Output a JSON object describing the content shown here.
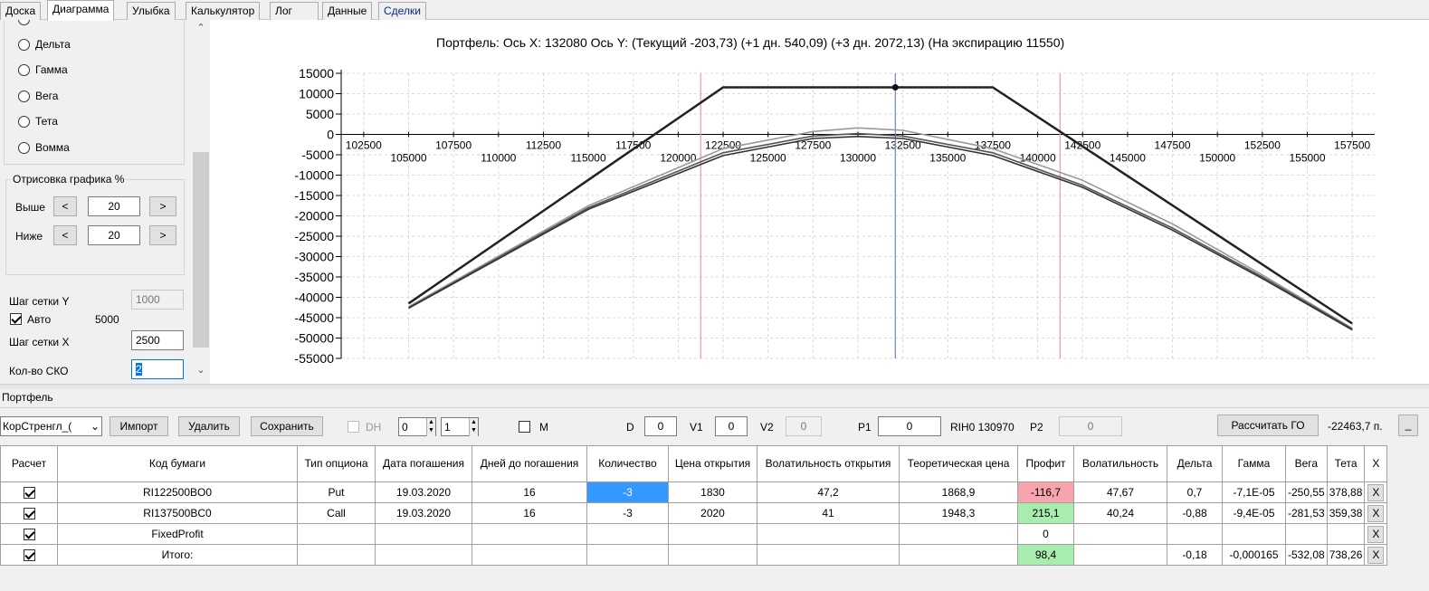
{
  "tabs": [
    {
      "label": "Доска"
    },
    {
      "label": "Диаграмма"
    },
    {
      "label": "Улыбка"
    },
    {
      "label": "Калькулятор"
    },
    {
      "label": "Лог"
    },
    {
      "label": "Данные"
    },
    {
      "label": "Сделки"
    }
  ],
  "left": {
    "radios": [
      "Дельта",
      "Гамма",
      "Вега",
      "Тета",
      "Вомма"
    ],
    "render_group": {
      "title": "Отрисовка графика %",
      "above_label": "Выше",
      "above_value": "20",
      "below_label": "Ниже",
      "below_value": "20",
      "dec": "<",
      "inc": ">"
    },
    "grid_y_label": "Шаг сетки Y",
    "grid_y_value": "1000",
    "auto_label": "Авто",
    "auto_value": "5000",
    "grid_x_label": "Шаг сетки X",
    "grid_x_value": "2500",
    "sko_label": "Кол-во СКО",
    "sko_value": "2"
  },
  "chart_title": "Портфель: Ось X: 132080 Ось Y:  (Текущий -203,73)  (+1 дн. 540,09)  (+3 дн. 2072,13)  (На экспирацию 11550)",
  "chart_data": {
    "type": "line",
    "xlim": [
      101250,
      158750
    ],
    "ylim": [
      -55000,
      15000
    ],
    "y_ticks": [
      15000,
      10000,
      5000,
      0,
      -5000,
      -10000,
      -15000,
      -20000,
      -25000,
      -30000,
      -35000,
      -40000,
      -45000,
      -50000,
      -55000
    ],
    "x_ticks_upper": [
      102500,
      107500,
      112500,
      117500,
      122500,
      127500,
      132500,
      137500,
      142500,
      147500,
      152500,
      157500
    ],
    "x_ticks_lower": [
      105000,
      110000,
      115000,
      120000,
      125000,
      130000,
      135000,
      140000,
      145000,
      150000,
      155000
    ],
    "current_x": 132080,
    "sd_lines": [
      121250,
      141250
    ],
    "series": [
      {
        "values": [
          [
            105000,
            -41500
          ],
          [
            122500,
            11550
          ],
          [
            137500,
            11550
          ],
          [
            157500,
            -46450
          ]
        ],
        "color": "#222222"
      },
      {
        "values": [
          [
            105000,
            -42300
          ],
          [
            115000,
            -17500
          ],
          [
            122500,
            -3500
          ],
          [
            127500,
            700
          ],
          [
            130000,
            1600
          ],
          [
            132500,
            1000
          ],
          [
            137500,
            -3500
          ],
          [
            142500,
            -11300
          ],
          [
            147500,
            -22000
          ],
          [
            152500,
            -34500
          ],
          [
            157500,
            -47600
          ]
        ],
        "color": "#999999"
      },
      {
        "values": [
          [
            105000,
            -42500
          ],
          [
            115000,
            -18000
          ],
          [
            122500,
            -4500
          ],
          [
            127500,
            -400
          ],
          [
            130000,
            200
          ],
          [
            132500,
            -400
          ],
          [
            137500,
            -4500
          ],
          [
            142500,
            -12500
          ],
          [
            147500,
            -23000
          ],
          [
            152500,
            -35000
          ],
          [
            157500,
            -47800
          ]
        ],
        "color": "#555555"
      },
      {
        "values": [
          [
            105000,
            -42700
          ],
          [
            115000,
            -18400
          ],
          [
            122500,
            -5200
          ],
          [
            127500,
            -1000
          ],
          [
            130000,
            -500
          ],
          [
            132500,
            -1000
          ],
          [
            137500,
            -5200
          ],
          [
            142500,
            -13000
          ],
          [
            147500,
            -23500
          ],
          [
            152500,
            -35400
          ],
          [
            157500,
            -48000
          ]
        ],
        "color": "#333333"
      }
    ],
    "marker": [
      132080,
      11550
    ]
  },
  "portfolio": {
    "title": "Портфель",
    "combo_value": "КорСтренгл_(",
    "import_label": "Импорт",
    "delete_label": "Удалить",
    "save_label": "Сохранить",
    "dh_label": "DH",
    "spin1": "0",
    "spin2": "1",
    "m_label": "M",
    "d_label": "D",
    "d_value": "0",
    "v1_label": "V1",
    "v1_value": "0",
    "v2_label": "V2",
    "v2_value": "0",
    "p1_label": "P1",
    "p1_value": "0",
    "rih_label": "RIH0 130970",
    "p2_label": "P2",
    "p2_value": "0",
    "calc_go_label": "Рассчитать ГО",
    "go_value": "-22463,7 п.",
    "more_label": "_"
  },
  "table": {
    "headers": [
      "Расчет",
      "Код бумаги",
      "Тип опциона",
      "Дата погашения",
      "Дней до погашения",
      "Количество",
      "Цена открытия",
      "Волатильность открытия",
      "Теоретическая цена",
      "Профит",
      "Волатильность",
      "Дельта",
      "Гамма",
      "Вега",
      "Тета",
      "X"
    ],
    "rows": [
      [
        "",
        "RI122500BO0",
        "Put",
        "19.03.2020",
        "16",
        "-3",
        "1830",
        "47,2",
        "1868,9",
        "-116,7",
        "47,67",
        "0,7",
        "-7,1E-05",
        "-250,55",
        "378,88",
        "X"
      ],
      [
        "",
        "RI137500BC0",
        "Call",
        "19.03.2020",
        "16",
        "-3",
        "2020",
        "41",
        "1948,3",
        "215,1",
        "40,24",
        "-0,88",
        "-9,4E-05",
        "-281,53",
        "359,38",
        "X"
      ],
      [
        "",
        "FixedProfit",
        "",
        "",
        "",
        "",
        "",
        "",
        "",
        "0",
        "",
        "",
        "",
        "",
        "",
        "X"
      ],
      [
        "",
        "Итого:",
        "",
        "",
        "",
        "",
        "",
        "",
        "",
        "98,4",
        "",
        "-0,18",
        "-0,000165",
        "-532,08",
        "738,26",
        "X"
      ]
    ],
    "profit_colors": [
      "#f7a4ae",
      "#a8ecae",
      "",
      "#a8ecae"
    ],
    "qty_selected_color": "#3399ff"
  }
}
